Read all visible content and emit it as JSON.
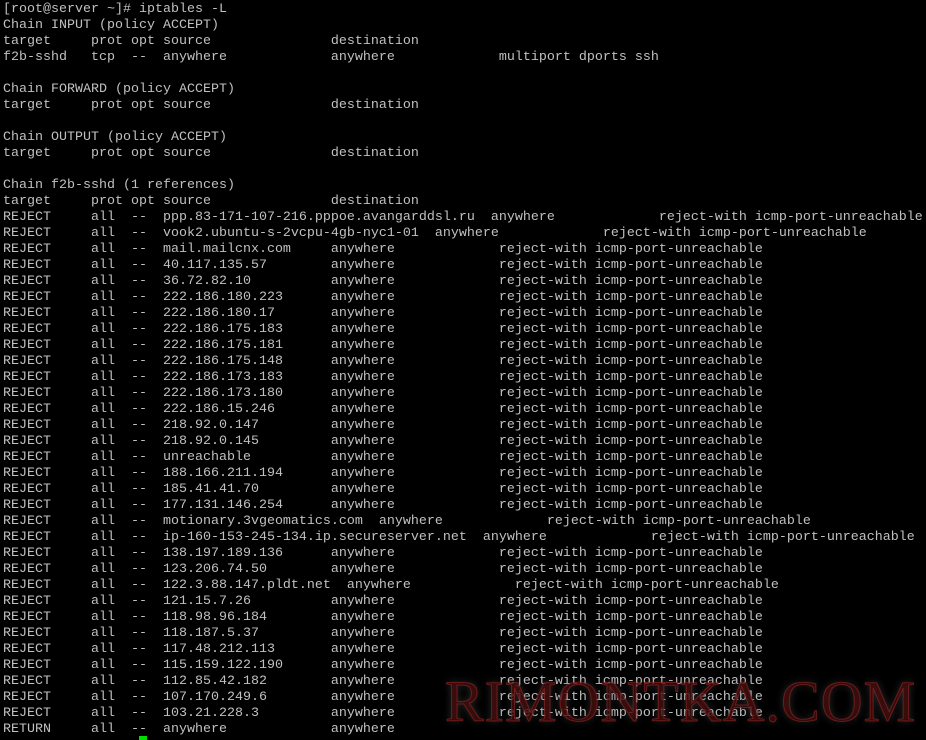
{
  "terminal": {
    "colors": {
      "background": "#000000",
      "text": "#c0c0c0",
      "cursor": "#00e000",
      "watermark": "#5a1010"
    },
    "lines": [
      "[root@server ~]# iptables -L",
      "Chain INPUT (policy ACCEPT)",
      "target     prot opt source               destination",
      "f2b-sshd   tcp  --  anywhere             anywhere             multiport dports ssh",
      "",
      "Chain FORWARD (policy ACCEPT)",
      "target     prot opt source               destination",
      "",
      "Chain OUTPUT (policy ACCEPT)",
      "target     prot opt source               destination",
      "",
      "Chain f2b-sshd (1 references)",
      "target     prot opt source               destination",
      "REJECT     all  --  ppp.83-171-107-216.pppoe.avangarddsl.ru  anywhere             reject-with icmp-port-unreachable",
      "REJECT     all  --  vook2.ubuntu-s-2vcpu-4gb-nyc1-01  anywhere             reject-with icmp-port-unreachable",
      "REJECT     all  --  mail.mailcnx.com     anywhere             reject-with icmp-port-unreachable",
      "REJECT     all  --  40.117.135.57        anywhere             reject-with icmp-port-unreachable",
      "REJECT     all  --  36.72.82.10          anywhere             reject-with icmp-port-unreachable",
      "REJECT     all  --  222.186.180.223      anywhere             reject-with icmp-port-unreachable",
      "REJECT     all  --  222.186.180.17       anywhere             reject-with icmp-port-unreachable",
      "REJECT     all  --  222.186.175.183      anywhere             reject-with icmp-port-unreachable",
      "REJECT     all  --  222.186.175.181      anywhere             reject-with icmp-port-unreachable",
      "REJECT     all  --  222.186.175.148      anywhere             reject-with icmp-port-unreachable",
      "REJECT     all  --  222.186.173.183      anywhere             reject-with icmp-port-unreachable",
      "REJECT     all  --  222.186.173.180      anywhere             reject-with icmp-port-unreachable",
      "REJECT     all  --  222.186.15.246       anywhere             reject-with icmp-port-unreachable",
      "REJECT     all  --  218.92.0.147         anywhere             reject-with icmp-port-unreachable",
      "REJECT     all  --  218.92.0.145         anywhere             reject-with icmp-port-unreachable",
      "REJECT     all  --  unreachable          anywhere             reject-with icmp-port-unreachable",
      "REJECT     all  --  188.166.211.194      anywhere             reject-with icmp-port-unreachable",
      "REJECT     all  --  185.41.41.70         anywhere             reject-with icmp-port-unreachable",
      "REJECT     all  --  177.131.146.254      anywhere             reject-with icmp-port-unreachable",
      "REJECT     all  --  motionary.3vgeomatics.com  anywhere             reject-with icmp-port-unreachable",
      "REJECT     all  --  ip-160-153-245-134.ip.secureserver.net  anywhere             reject-with icmp-port-unreachable",
      "REJECT     all  --  138.197.189.136      anywhere             reject-with icmp-port-unreachable",
      "REJECT     all  --  123.206.74.50        anywhere             reject-with icmp-port-unreachable",
      "REJECT     all  --  122.3.88.147.pldt.net  anywhere             reject-with icmp-port-unreachable",
      "REJECT     all  --  121.15.7.26          anywhere             reject-with icmp-port-unreachable",
      "REJECT     all  --  118.98.96.184        anywhere             reject-with icmp-port-unreachable",
      "REJECT     all  --  118.187.5.37         anywhere             reject-with icmp-port-unreachable",
      "REJECT     all  --  117.48.212.113       anywhere             reject-with icmp-port-unreachable",
      "REJECT     all  --  115.159.122.190      anywhere             reject-with icmp-port-unreachable",
      "REJECT     all  --  112.85.42.182        anywhere             reject-with icmp-port-unreachable",
      "REJECT     all  --  107.170.249.6        anywhere             reject-with icmp-port-unreachable",
      "REJECT     all  --  103.21.228.3         anywhere             reject-with icmp-port-unreachable",
      "RETURN     all  --  anywhere             anywhere"
    ]
  },
  "watermark": {
    "text": "RIMONTKA.COM"
  }
}
